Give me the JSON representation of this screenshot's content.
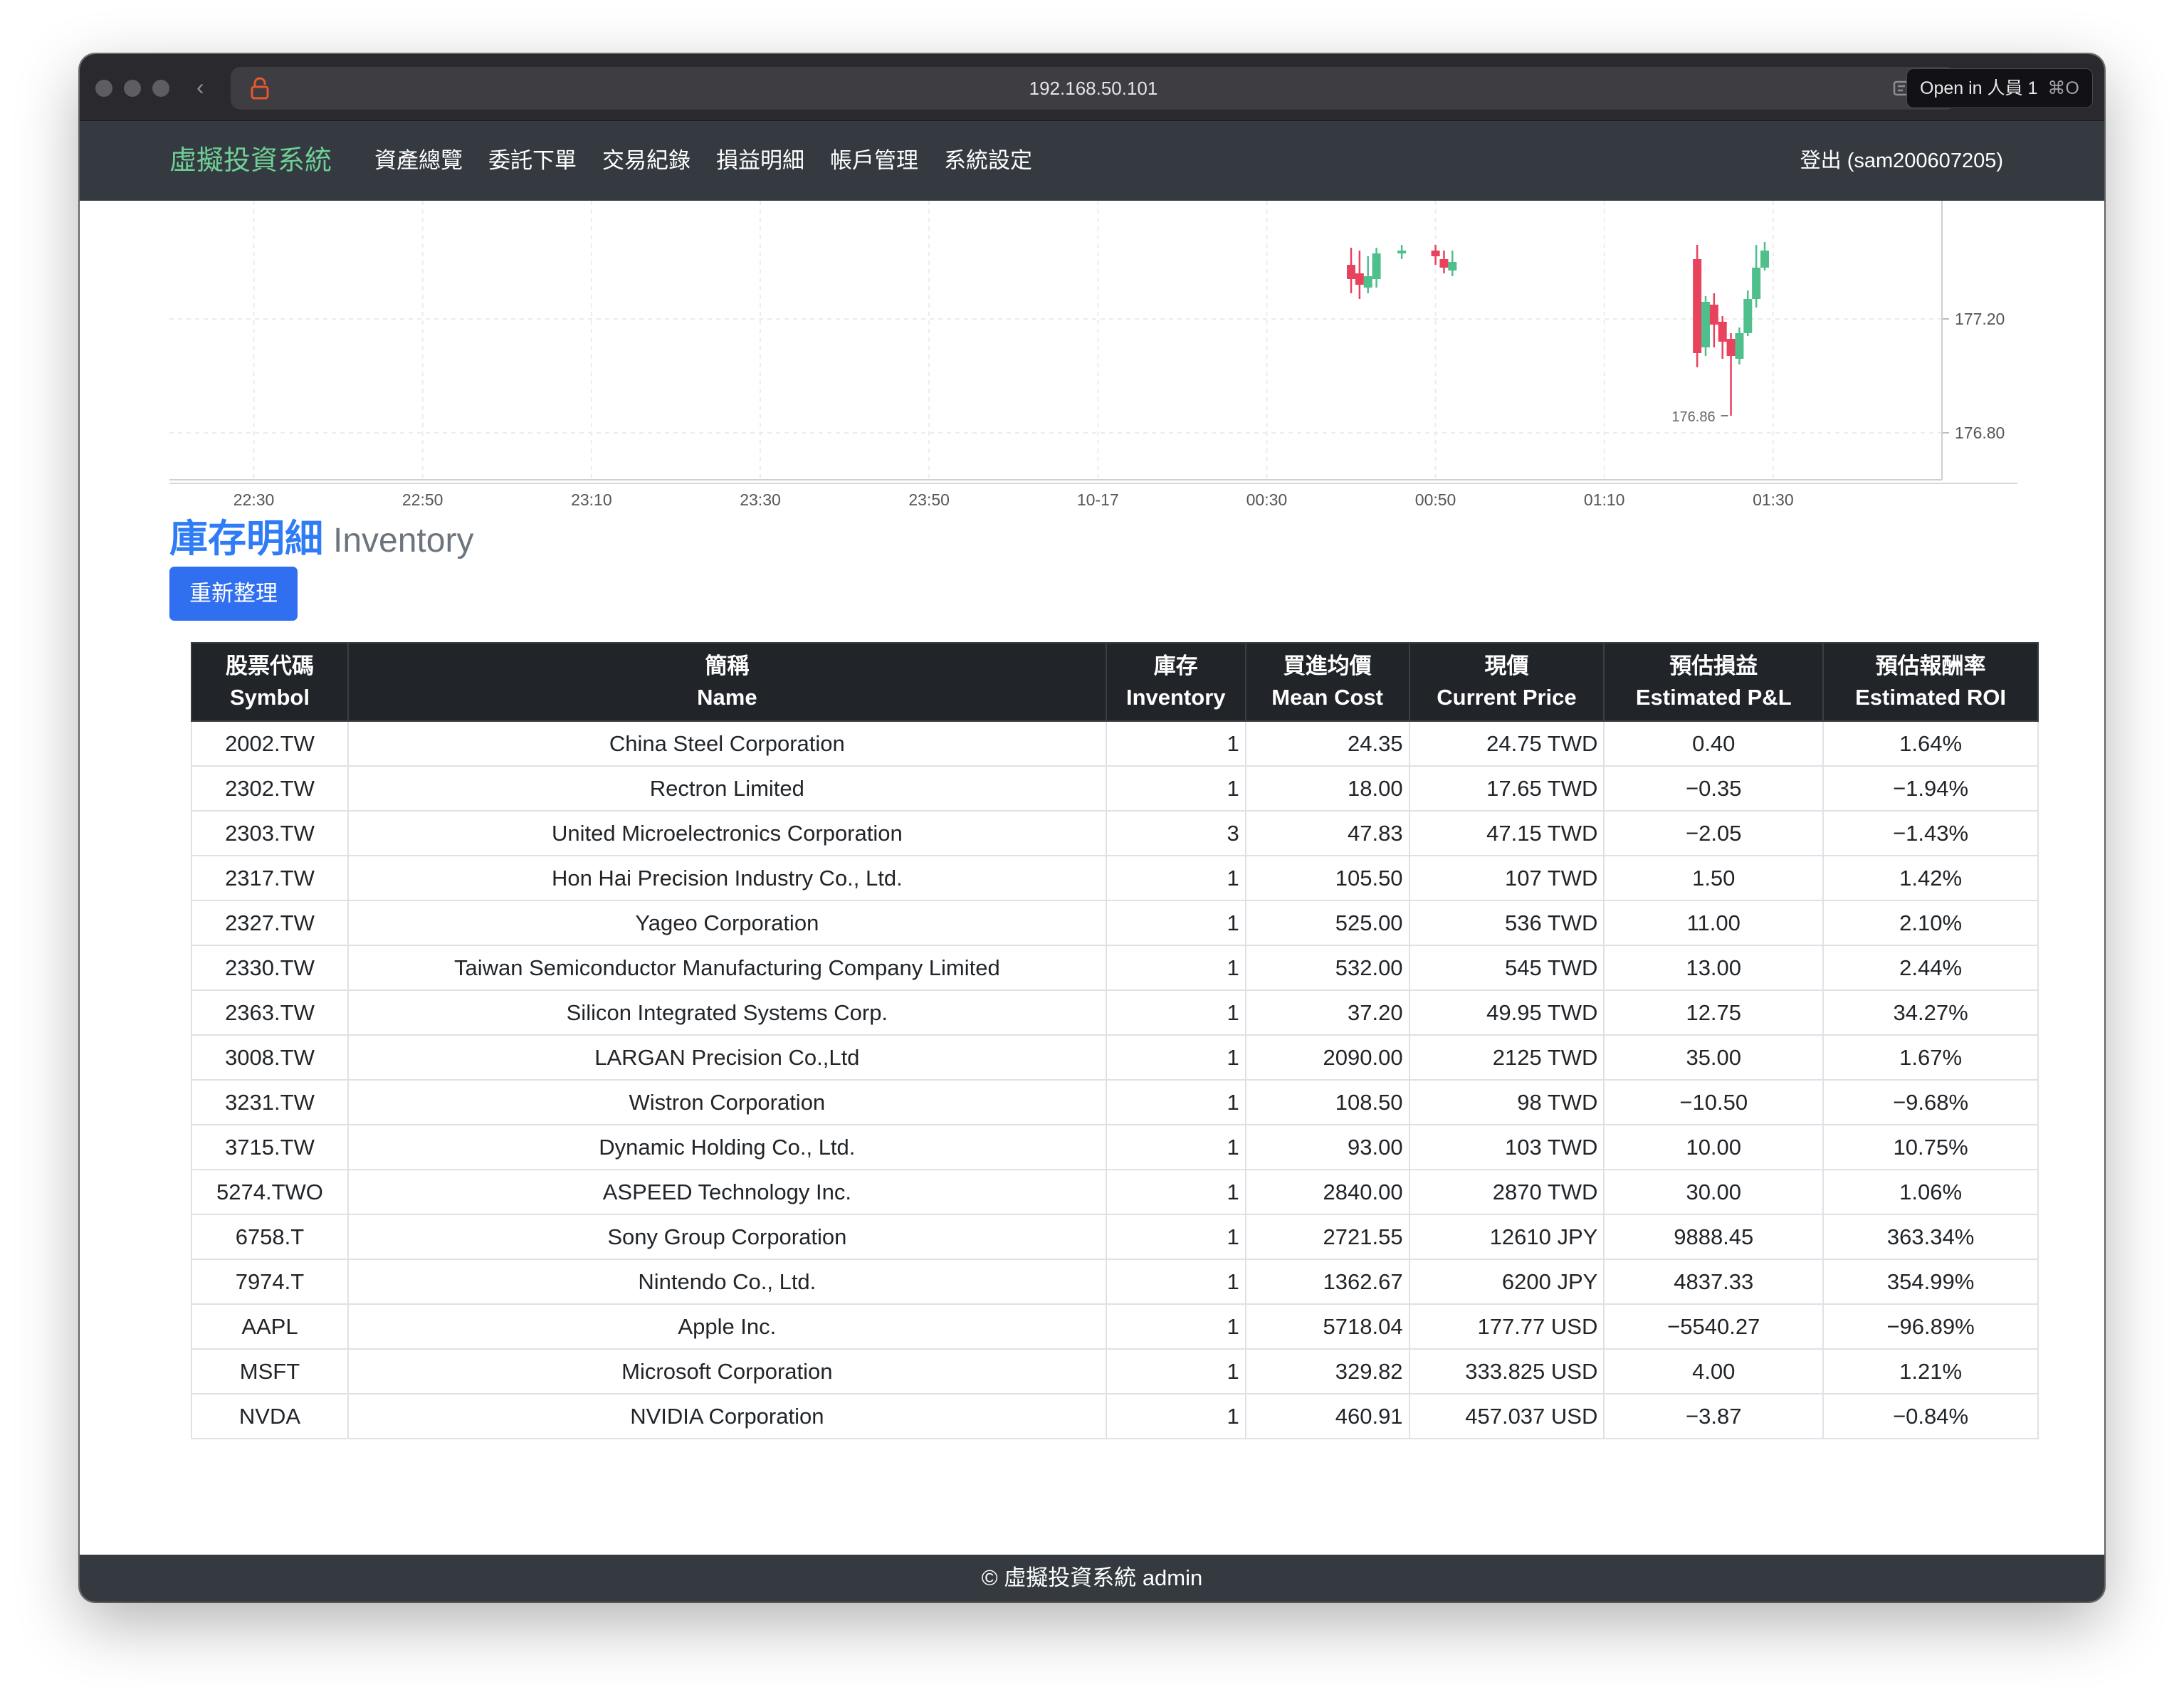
{
  "browser": {
    "url": "192.168.50.101",
    "open_in_label": "Open in 人員 1",
    "open_in_shortcut": "⌘O"
  },
  "navbar": {
    "brand": "虛擬投資系統",
    "items": [
      "資產總覽",
      "委託下單",
      "交易紀錄",
      "損益明細",
      "帳戶管理",
      "系統設定"
    ],
    "logout": "登出 (sam200607205)"
  },
  "chart_data": {
    "type": "candlestick",
    "x_tick_labels": [
      "22:30",
      "22:50",
      "23:10",
      "23:30",
      "23:50",
      "10-17",
      "00:30",
      "00:50",
      "01:10",
      "01:30"
    ],
    "y_tick_labels": [
      "177.20",
      "176.80"
    ],
    "annotations": [
      "176.86"
    ],
    "colors": {
      "up": "#4fbf8c",
      "down": "#e8425c"
    },
    "candles": [
      {
        "x": "00:40",
        "open": 177.39,
        "close": 177.34,
        "high": 177.45,
        "low": 177.29
      },
      {
        "x": "00:41",
        "open": 177.36,
        "close": 177.32,
        "high": 177.44,
        "low": 177.27
      },
      {
        "x": "00:42",
        "open": 177.31,
        "close": 177.35,
        "high": 177.42,
        "low": 177.29
      },
      {
        "x": "00:43",
        "open": 177.34,
        "close": 177.43,
        "high": 177.45,
        "low": 177.31
      },
      {
        "x": "00:46",
        "open": 177.43,
        "close": 177.44,
        "high": 177.46,
        "low": 177.41
      },
      {
        "x": "00:50",
        "open": 177.44,
        "close": 177.42,
        "high": 177.46,
        "low": 177.39
      },
      {
        "x": "00:51",
        "open": 177.41,
        "close": 177.38,
        "high": 177.44,
        "low": 177.36
      },
      {
        "x": "00:52",
        "open": 177.37,
        "close": 177.4,
        "high": 177.44,
        "low": 177.35
      },
      {
        "x": "01:21",
        "open": 177.41,
        "close": 177.08,
        "high": 177.46,
        "low": 177.03
      },
      {
        "x": "01:22",
        "open": 177.1,
        "close": 177.26,
        "high": 177.28,
        "low": 177.07
      },
      {
        "x": "01:23",
        "open": 177.25,
        "close": 177.18,
        "high": 177.29,
        "low": 177.1
      },
      {
        "x": "01:24",
        "open": 177.19,
        "close": 177.12,
        "high": 177.21,
        "low": 177.06
      },
      {
        "x": "01:25",
        "open": 177.13,
        "close": 177.07,
        "high": 177.15,
        "low": 176.86
      },
      {
        "x": "01:26",
        "open": 177.06,
        "close": 177.15,
        "high": 177.17,
        "low": 177.04
      },
      {
        "x": "01:27",
        "open": 177.15,
        "close": 177.27,
        "high": 177.3,
        "low": 177.14
      },
      {
        "x": "01:28",
        "open": 177.27,
        "close": 177.38,
        "high": 177.46,
        "low": 177.24
      },
      {
        "x": "01:29",
        "open": 177.38,
        "close": 177.44,
        "high": 177.47,
        "low": 177.37
      }
    ]
  },
  "section": {
    "title_zh": "庫存明細",
    "title_en": "Inventory",
    "refresh_label": "重新整理"
  },
  "table": {
    "headers": [
      {
        "zh": "股票代碼",
        "en": "Symbol"
      },
      {
        "zh": "簡稱",
        "en": "Name"
      },
      {
        "zh": "庫存",
        "en": "Inventory"
      },
      {
        "zh": "買進均價",
        "en": "Mean Cost"
      },
      {
        "zh": "現價",
        "en": "Current Price"
      },
      {
        "zh": "預估損益",
        "en": "Estimated P&L"
      },
      {
        "zh": "預估報酬率",
        "en": "Estimated ROI"
      }
    ],
    "rows": [
      [
        "2002.TW",
        "China Steel Corporation",
        "1",
        "24.35",
        "24.75 TWD",
        "0.40",
        "1.64%"
      ],
      [
        "2302.TW",
        "Rectron Limited",
        "1",
        "18.00",
        "17.65 TWD",
        "−0.35",
        "−1.94%"
      ],
      [
        "2303.TW",
        "United Microelectronics Corporation",
        "3",
        "47.83",
        "47.15 TWD",
        "−2.05",
        "−1.43%"
      ],
      [
        "2317.TW",
        "Hon Hai Precision Industry Co., Ltd.",
        "1",
        "105.50",
        "107 TWD",
        "1.50",
        "1.42%"
      ],
      [
        "2327.TW",
        "Yageo Corporation",
        "1",
        "525.00",
        "536 TWD",
        "11.00",
        "2.10%"
      ],
      [
        "2330.TW",
        "Taiwan Semiconductor Manufacturing Company Limited",
        "1",
        "532.00",
        "545 TWD",
        "13.00",
        "2.44%"
      ],
      [
        "2363.TW",
        "Silicon Integrated Systems Corp.",
        "1",
        "37.20",
        "49.95 TWD",
        "12.75",
        "34.27%"
      ],
      [
        "3008.TW",
        "LARGAN Precision Co.,Ltd",
        "1",
        "2090.00",
        "2125 TWD",
        "35.00",
        "1.67%"
      ],
      [
        "3231.TW",
        "Wistron Corporation",
        "1",
        "108.50",
        "98 TWD",
        "−10.50",
        "−9.68%"
      ],
      [
        "3715.TW",
        "Dynamic Holding Co., Ltd.",
        "1",
        "93.00",
        "103 TWD",
        "10.00",
        "10.75%"
      ],
      [
        "5274.TWO",
        "ASPEED Technology Inc.",
        "1",
        "2840.00",
        "2870 TWD",
        "30.00",
        "1.06%"
      ],
      [
        "6758.T",
        "Sony Group Corporation",
        "1",
        "2721.55",
        "12610 JPY",
        "9888.45",
        "363.34%"
      ],
      [
        "7974.T",
        "Nintendo Co., Ltd.",
        "1",
        "1362.67",
        "6200 JPY",
        "4837.33",
        "354.99%"
      ],
      [
        "AAPL",
        "Apple Inc.",
        "1",
        "5718.04",
        "177.77 USD",
        "−5540.27",
        "−96.89%"
      ],
      [
        "MSFT",
        "Microsoft Corporation",
        "1",
        "329.82",
        "333.825 USD",
        "4.00",
        "1.21%"
      ],
      [
        "NVDA",
        "NVIDIA Corporation",
        "1",
        "460.91",
        "457.037 USD",
        "−3.87",
        "−0.84%"
      ]
    ]
  },
  "footer": {
    "text": "© 虛擬投資系統 admin"
  }
}
